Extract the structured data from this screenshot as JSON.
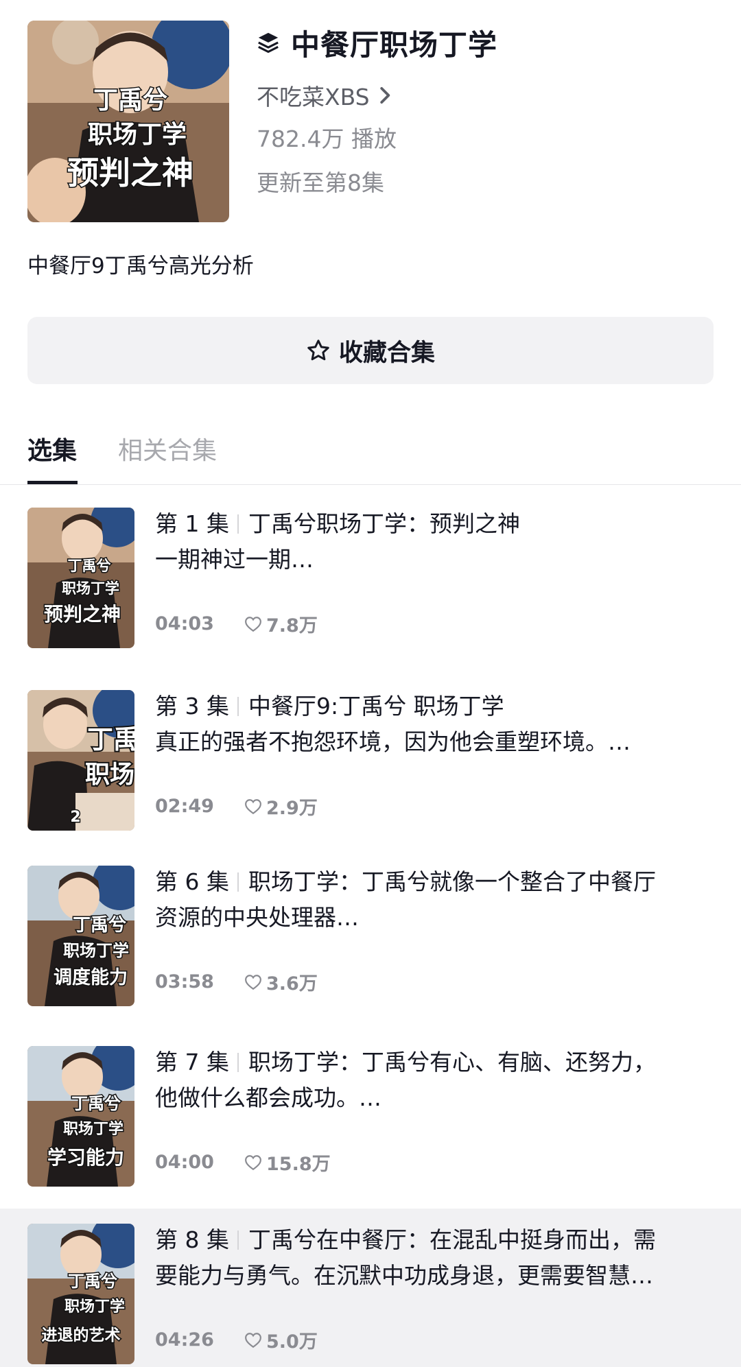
{
  "collection": {
    "title": "中餐厅职场丁学",
    "author": "不吃菜XBS",
    "plays": "782.4万 播放",
    "updated": "更新至第8集",
    "description": "中餐厅9丁禹兮高光分析",
    "cover_lines": [
      "丁禹兮",
      "职场丁学",
      "预判之神"
    ],
    "favorite_label": "收藏合集"
  },
  "tabs": [
    {
      "label": "选集",
      "active": true
    },
    {
      "label": "相关合集",
      "active": false
    }
  ],
  "episodes": [
    {
      "number": "第 1 集",
      "line1": "丁禹兮职场丁学：预判之神",
      "line2": "一期神过一期…",
      "duration": "04:03",
      "likes": "7.8万",
      "thumb_lines": [
        "丁禹兮",
        "职场丁学",
        "预判之神"
      ]
    },
    {
      "number": "第 3 集",
      "line1": "中餐厅9:丁禹兮 职场丁学",
      "line2": "真正的强者不抱怨环境，因为他会重塑环境。…",
      "duration": "02:49",
      "likes": "2.9万",
      "thumb_lines": [
        "丁禹",
        "职场",
        "2"
      ]
    },
    {
      "number": "第 6 集",
      "line1": "职场丁学：丁禹兮就像一个整合了中餐厅",
      "line2": "资源的中央处理器…",
      "duration": "03:58",
      "likes": "3.6万",
      "thumb_lines": [
        "丁禹兮",
        "职场丁学",
        "调度能力"
      ]
    },
    {
      "number": "第 7 集",
      "line1": "职场丁学：丁禹兮有心、有脑、还努力，",
      "line2": "他做什么都会成功。…",
      "duration": "04:00",
      "likes": "15.8万",
      "thumb_lines": [
        "丁禹兮",
        "职场丁学",
        "学习能力"
      ]
    },
    {
      "number": "第 8 集",
      "line1": "丁禹兮在中餐厅：在混乱中挺身而出，需",
      "line2": "要能力与勇气。在沉默中功成身退，更需要智慧…",
      "duration": "04:26",
      "likes": "5.0万",
      "thumb_lines": [
        "丁禹兮",
        "职场丁学",
        "进退的艺术"
      ]
    }
  ],
  "colors": {
    "text_primary": "#161823",
    "text_secondary": "#8a8b91",
    "button_bg": "#f2f2f4",
    "highlight_row": "#f1f1f3"
  }
}
